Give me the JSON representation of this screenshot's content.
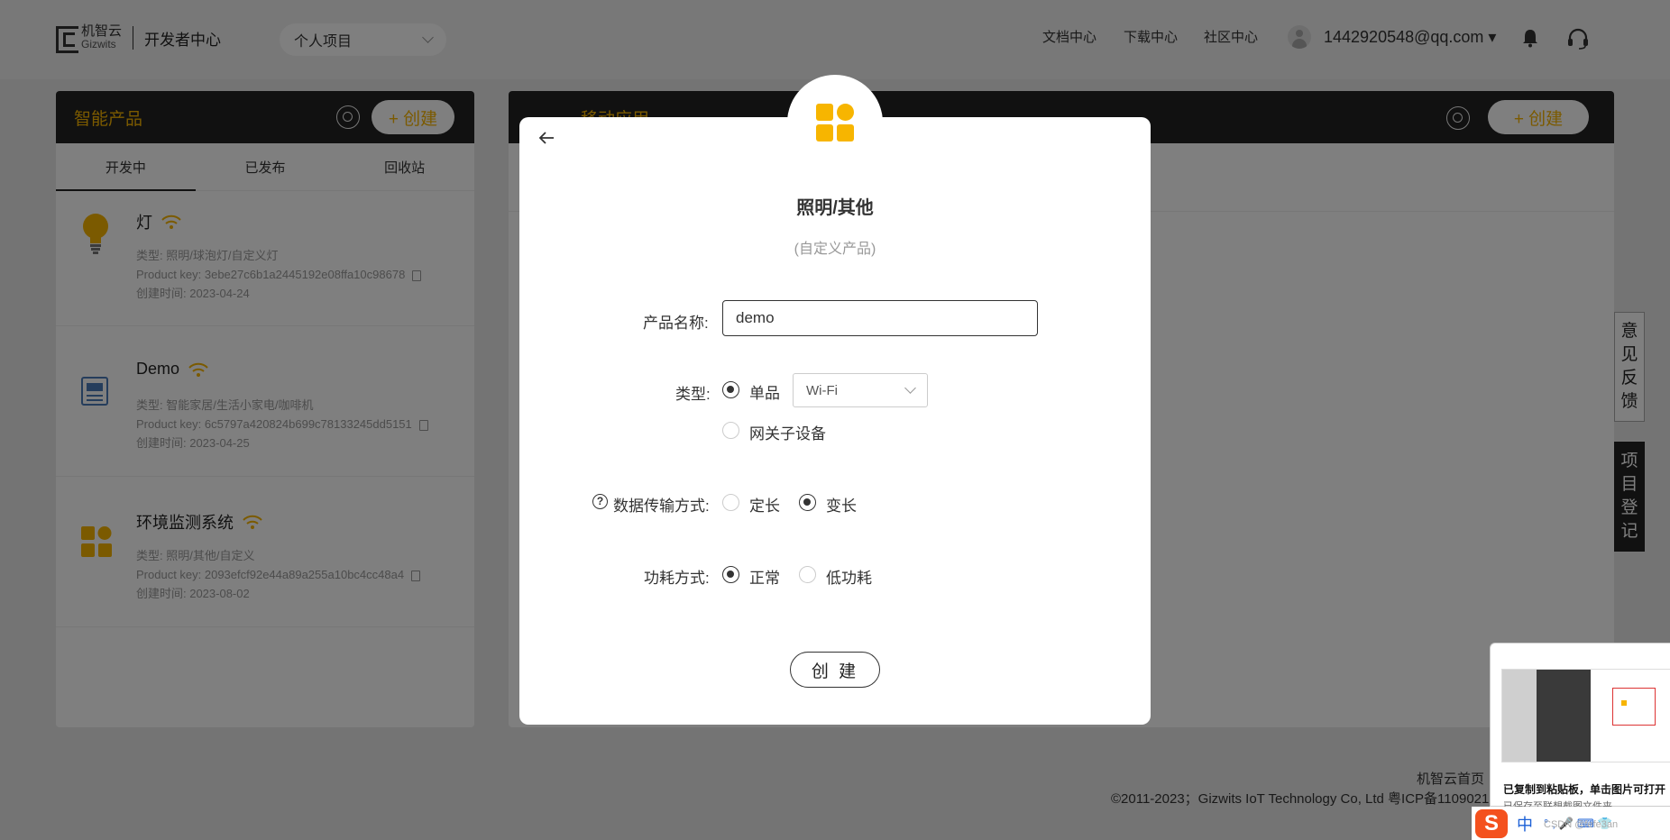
{
  "topbar": {
    "logo_cn": "机智云",
    "logo_en": "Gizwits",
    "logo_title": "开发者中心",
    "project_select": "个人项目",
    "nav": [
      "文档中心",
      "下载中心",
      "社区中心"
    ],
    "user_email": "1442920548@qq.com ▾"
  },
  "left_panel": {
    "title": "智能产品",
    "create_label": "+ 创建",
    "tabs": [
      "开发中",
      "已发布",
      "回收站"
    ],
    "products": [
      {
        "name": "灯",
        "type": "类型: 照明/球泡灯/自定义灯",
        "key": "Product key: 3ebe27c6b1a2445192e08ffa10c98678",
        "created": "创建时间: 2023-04-24"
      },
      {
        "name": "Demo",
        "type": "类型: 智能家居/生活小家电/咖啡机",
        "key": "Product key: 6c5797a420824b699c78133245dd5151",
        "created": "创建时间: 2023-04-25"
      },
      {
        "name": "环境监测系统",
        "type": "类型: 照明/其他/自定义",
        "key": "Product key: 2093efcf92e44a89a255a10bc4cc48a4",
        "created": "创建时间: 2023-08-02"
      }
    ]
  },
  "right_panel": {
    "title": "移动应用",
    "create_label": "+ 创建"
  },
  "side_tabs": {
    "feedback": "意见反馈",
    "register": "项目登记"
  },
  "footer": {
    "home": "机智云首页",
    "copyright": "©2011-2023；Gizwits IoT Technology Co, Ltd 粤ICP备1109021"
  },
  "modal": {
    "title": "照明/其他",
    "subtitle": "(自定义产品)",
    "name_label": "产品名称:",
    "name_value": "demo",
    "type_label": "类型:",
    "type_options": [
      "单品",
      "网关子设备"
    ],
    "type_selected": "单品",
    "network_select": "Wi-Fi",
    "transfer_label": "数据传输方式:",
    "transfer_options": [
      "定长",
      "变长"
    ],
    "transfer_selected": "变长",
    "power_label": "功耗方式:",
    "power_options": [
      "正常",
      "低功耗"
    ],
    "power_selected": "正常",
    "create_button": "创 建"
  },
  "toast": {
    "text": "已复制到粘贴板，单击图片可打开",
    "sub": "已保存至联想截图文件夹"
  },
  "ime": {
    "logo": "S",
    "lang": "中",
    "rest": "°,🎤⌨👕",
    "watermark": "CSDN @fefe3an"
  },
  "colors": {
    "accent": "#f7b500",
    "dark": "#222222",
    "overlay": "rgba(0,0,0,0.5)"
  }
}
